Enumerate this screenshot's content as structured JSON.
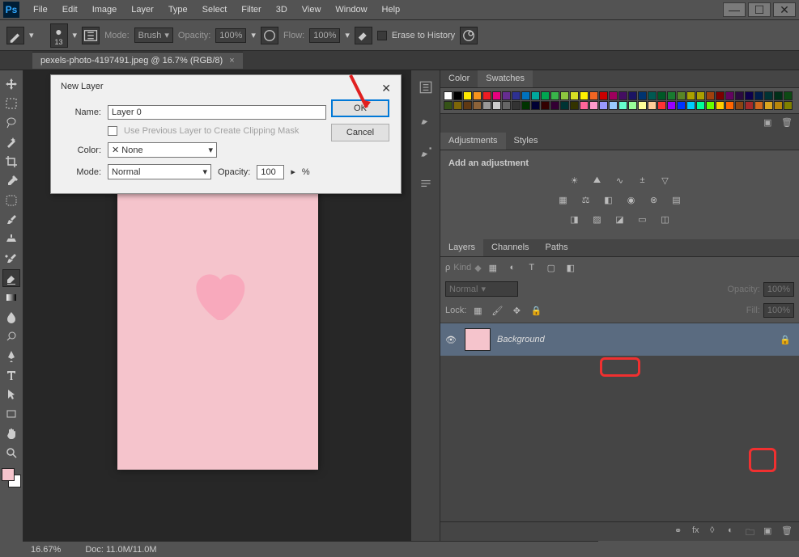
{
  "app": {
    "logo": "Ps"
  },
  "menu": [
    "File",
    "Edit",
    "Image",
    "Layer",
    "Type",
    "Select",
    "Filter",
    "3D",
    "View",
    "Window",
    "Help"
  ],
  "options": {
    "brush_size": "13",
    "mode_label": "Mode:",
    "mode_value": "Brush",
    "opacity_label": "Opacity:",
    "opacity_value": "100%",
    "flow_label": "Flow:",
    "flow_value": "100%",
    "erase_history_label": "Erase to History"
  },
  "document": {
    "tab_title": "pexels-photo-4197491.jpeg @ 16.7% (RGB/8)"
  },
  "status": {
    "zoom": "16.67%",
    "doc_label": "Doc:",
    "doc_size": "11.0M/11.0M"
  },
  "panels": {
    "color_tab": "Color",
    "swatches_tab": "Swatches",
    "adjustments_tab": "Adjustments",
    "styles_tab": "Styles",
    "adjustments_title": "Add an adjustment",
    "layers_tab": "Layers",
    "channels_tab": "Channels",
    "paths_tab": "Paths",
    "kind_label": "Kind",
    "blend_mode": "Normal",
    "opacity_label": "Opacity:",
    "opacity_value": "100%",
    "lock_label": "Lock:",
    "fill_label": "Fill:",
    "fill_value": "100%",
    "layer_background": "Background"
  },
  "dialog": {
    "title": "New Layer",
    "name_label": "Name:",
    "name_value": "Layer 0",
    "clip_mask_label": "Use Previous Layer to Create Clipping Mask",
    "color_label": "Color:",
    "color_value": "None",
    "mode_label": "Mode:",
    "mode_value": "Normal",
    "opacity_label": "Opacity:",
    "opacity_value": "100",
    "opacity_pct": "%",
    "ok": "OK",
    "cancel": "Cancel"
  },
  "swatch_colors": [
    "#ffffff",
    "#000000",
    "#fee900",
    "#f7941d",
    "#ed1c24",
    "#e6007e",
    "#662d91",
    "#2e3192",
    "#0072bc",
    "#00a99d",
    "#00a651",
    "#39b54a",
    "#8dc63f",
    "#d7df23",
    "#fff200",
    "#f26522",
    "#cc0000",
    "#9e005d",
    "#440e62",
    "#1b1464",
    "#003471",
    "#005952",
    "#005826",
    "#197b30",
    "#598527",
    "#aaa100",
    "#aba000",
    "#a0410d",
    "#7b0000",
    "#630460",
    "#2b0b3f",
    "#0d004c",
    "#001d4b",
    "#003333",
    "#002f18",
    "#0d4a14",
    "#355216",
    "#7d6608",
    "#603913",
    "#8c6239",
    "#999999",
    "#cccccc",
    "#666666",
    "#333333",
    "#003300",
    "#000033",
    "#330000",
    "#330033",
    "#003333",
    "#333300",
    "#ff6699",
    "#ff99cc",
    "#9999ff",
    "#99ccff",
    "#66ffcc",
    "#99ff99",
    "#ffff99",
    "#ffcc99",
    "#ff3333",
    "#9900ff",
    "#0033ff",
    "#00ccff",
    "#00ff99",
    "#66ff00",
    "#ffcc00",
    "#ff6600",
    "#8b4513",
    "#a52a2a",
    "#d2691e",
    "#daa520",
    "#b8860b",
    "#808000"
  ]
}
